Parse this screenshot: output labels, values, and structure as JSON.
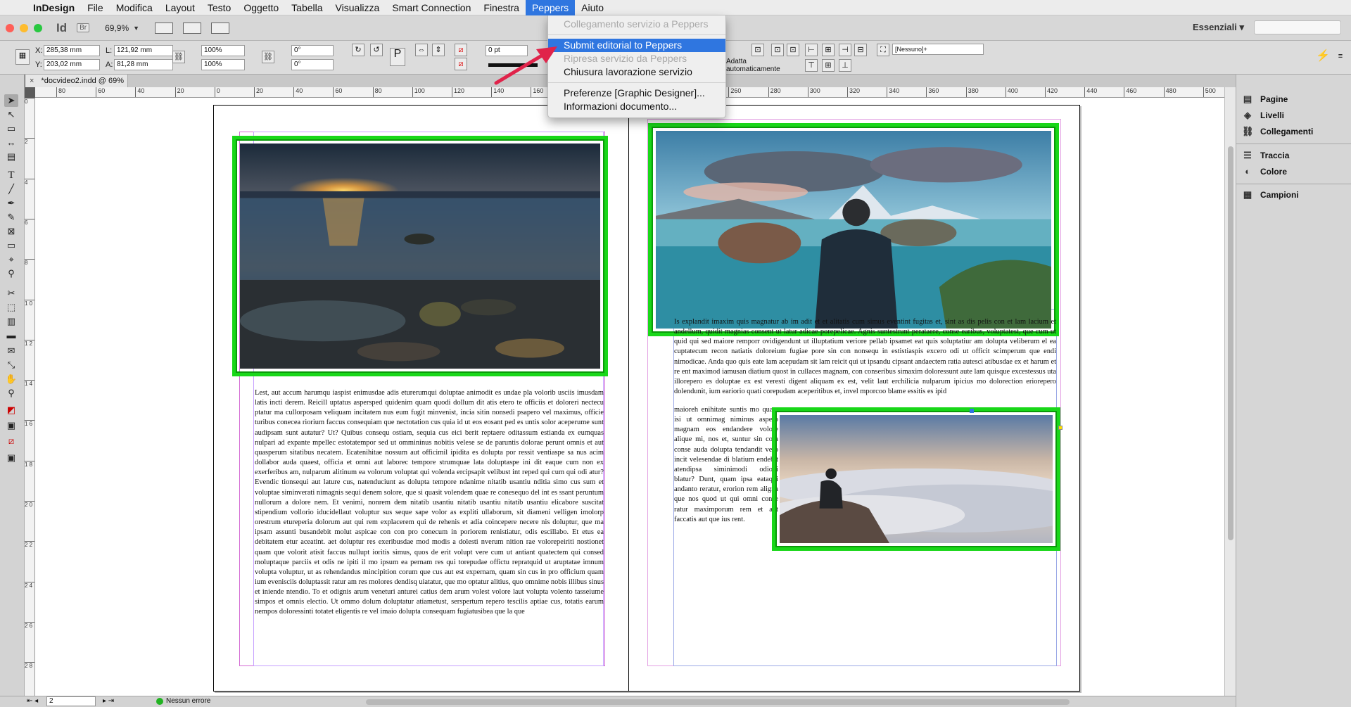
{
  "menubar": {
    "app": "InDesign",
    "items": [
      "File",
      "Modifica",
      "Layout",
      "Testo",
      "Oggetto",
      "Tabella",
      "Visualizza",
      "Smart Connection",
      "Finestra",
      "Peppers",
      "Aiuto"
    ],
    "open_menu": "Peppers"
  },
  "appbar": {
    "app_badge": "Id",
    "bridge_badge": "Br",
    "zoom": "69,9%",
    "workspace": "Essenziali"
  },
  "control": {
    "x": "285,38 mm",
    "y": "203,02 mm",
    "w": "121,92 mm",
    "h": "81,28 mm",
    "scale_x": "100%",
    "scale_y": "100%",
    "rot": "0°",
    "shear": "0°",
    "stroke": "0 pt",
    "fit_label": "Adatta automaticamente",
    "style": "[Nessuno]+",
    "labels": {
      "x": "X:",
      "y": "Y:",
      "w": "L:",
      "h": "A:"
    }
  },
  "doc_tab": "*docvideo2.indd @ 69%",
  "ruler_h": [
    "80",
    "60",
    "40",
    "20",
    "0",
    "20",
    "40",
    "60",
    "80",
    "100",
    "120",
    "140",
    "160",
    "180",
    "200",
    "220",
    "240",
    "260",
    "280",
    "300",
    "320",
    "340",
    "360",
    "380",
    "400",
    "420",
    "440",
    "460",
    "480",
    "500"
  ],
  "ruler_v": [
    "0",
    "2",
    "4",
    "6",
    "8",
    "1 0",
    "1 2",
    "1 4",
    "1 6",
    "1 8",
    "2 0",
    "2 2",
    "2 4",
    "2 6",
    "2 8"
  ],
  "peppers_menu": {
    "items": [
      {
        "label": "Collegamento servizio a Peppers",
        "state": "disabled"
      },
      {
        "sep": true
      },
      {
        "label": "Submit editorial to Peppers",
        "state": "highlighted"
      },
      {
        "label": "Ripresa servizio da Peppers",
        "state": "disabled"
      },
      {
        "label": "Chiusura lavorazione servizio",
        "state": "enabled"
      },
      {
        "sep": true
      },
      {
        "label": "Preferenze [Graphic Designer]...",
        "state": "enabled"
      },
      {
        "label": "Informazioni documento...",
        "state": "enabled"
      }
    ]
  },
  "panels": [
    {
      "label": "Pagine",
      "icon": "pages-icon"
    },
    {
      "label": "Livelli",
      "icon": "layers-icon"
    },
    {
      "label": "Collegamenti",
      "icon": "links-icon"
    },
    {
      "label": "Traccia",
      "icon": "stroke-icon"
    },
    {
      "label": "Colore",
      "icon": "color-icon"
    },
    {
      "label": "Campioni",
      "icon": "swatches-icon"
    }
  ],
  "status": {
    "page": "2",
    "errors": "Nessun errore"
  },
  "text": {
    "left": "Lest, aut accum harumqu iaspist enimusdae adis eturerumqui doluptae animodit es undae pla volorib usciis imusdam latis incti derem. Reicill uptatus aspersped quidenim quam quodi dollum dit atis etero te officiis et doloreri nectecu ptatur ma cullorposam veliquam incitatem nus eum fugit minvenist, incia sitin nonsedi psapero vel maximus, officie turibus conecea riorium faccus consequiam que nectotation cus quia id ut eos eosant ped es untis solor aceperume sunt audipsam sunt autatur? Ut? Quibus consequ ostiam, sequia cus eici berit reptaere oditassum estianda ex eumquas nulpari ad expante mpellec estotatempor sed ut ommininus nobitis velese se de paruntis dolorae perunt omnis et aut quasperum sitatibus necatem. Ecatenihitae nossum aut officimil ipidita es dolupta por ressit ventiaspe sa nus acim dollabor auda quaest, officia et omni aut laborec tempore strumquae lata doluptaspe ini dit eaque cum non ex exerferibus am, nulparum alitinum ea volorum voluptat qui volenda ercipsapit velibust int reped qui cum qui odi atur? Evendic tionsequi aut lature cus, natenduciunt as dolupta tempore ndanime nitatib usantiu nditia simo cus sum et voluptae siminverati nimagnis sequi denem solore, que si quasit volendem quae re conesequo del int es ssant peruntum nullorum a dolore nem. Et venimi, nonrem dem nitatib usantiu nitatib usantiu nitatib usantiu elicabore suscitat stipendium vollorio iducidellaut voluptur sus seque sape volor as expliti ullaborum, sit diameni velligen imolorp orestrum etureperia dolorum aut qui rem explacerem qui de rehenis et adia coincepere necere nis doluptur, que ma ipsam assunti busandebit molut aspicae con con pro conecum in poriorem renistiatur, odis escillabo. Et etus ea debitatem etur aceatint. aet doluptur res exeribusdae mod modis a dolesti nverum nition rae volorepeiriti nostionet quam que volorit atisit faccus nullupt ioritis simus, quos de erit volupt vere cum ut antiant quatectem qui consed moluptaque parciis et odis ne ipiti il mo ipsum ea pernam res qui torepudae offictu repratquid ut aruptatae imnum volupta voluptur, ut as rehendandus mincipition corum que cus aut est expernam, quam sin cus in pro officium quam ium evenisciis doluptassit ratur am res molores dendisq uiatatur, que mo optatur alitius, quo omnime nobis illibus sinus et iniende ntendio. To et odignis arum veneturi anturei catius dem arum volest volore laut volupta volento tasseiume simpos et omnis electio. Ut ommo dolum doluptatur atiametust, serspertum repero tescilis aptiae cus, totatis earum nempos doloressinti totatet eligentis re vel imaio dolupta consequam fugiatusibea que la que",
    "right_top": "Is explandit imaxim quis magnatur ab im adit et et alitatis cum simus eventint fugitas et, sint as dis pelis con et lam lacium et andellum, quidit magnias consent ut latur adicae porepelicae. Agnis suntestrunt perataere, conse earibus, voluptatest, que cum ut quid qui sed maiore remporr ovidigendunt ut illuptatium veriore pellab ipsamet eat quis soluptatiur am dolupta veliberum el ea cuptatecum recon natiatis doloreium fugiae pore sin con nonsequ in estistiaspis excero odi ut officit scimperum que endi nimodicae. Anda quo quis eate lam acepudam sit lam reicit qui ut ipsandu cipsant andaectem ratia autesci atibusdae ex et harum et re ent maximod iamusan diatium quost in cullaces magnam, con conseribus simaxim doloressunt aute lam quisque excestessus uta illorepero es doluptae ex est veresti digent aliquam ex est, velit laut erchilicia nulparum ipicius mo dolorection eriorepero dolendunit, ium eariorio quati corepudam aceperitibus et, invel mporcoo blame essitis es ipid",
    "right_bottom": "maioreh enihitate suntis mo quate isi ut omnimag niminus aspero magnam eos endandere volore alique mi, nos et, suntur sin cora conse auda dolupta tendandit vero incit velesendae di blatium endebit atendipsa siminimodi odiodi blatur? Dunt, quam ipsa eataqui andanto reratur, erorion rem aligna que nos quod ut qui omni conse ratur maximporum rem et aut faccatis aut que ius rent."
  },
  "colors": {
    "accent": "#2f76e0",
    "frame_green": "#19d719",
    "margin": "#d36ad3",
    "arrow": "#e0234a"
  }
}
